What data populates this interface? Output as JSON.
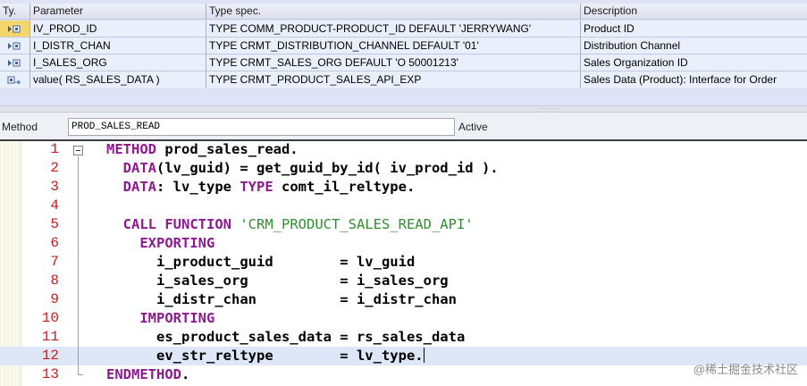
{
  "param_table": {
    "columns": [
      "Ty.",
      "Parameter",
      "Type spec.",
      "Description"
    ],
    "rows": [
      {
        "icon": "importing-param-icon",
        "parameter": "IV_PROD_ID",
        "type_spec": "TYPE COMM_PRODUCT-PRODUCT_ID  DEFAULT 'JERRYWANG'",
        "description": "Product ID",
        "selected": true
      },
      {
        "icon": "importing-param-icon",
        "parameter": "I_DISTR_CHAN",
        "type_spec": "TYPE CRMT_DISTRIBUTION_CHANNEL  DEFAULT '01'",
        "description": "Distribution Channel",
        "selected": false
      },
      {
        "icon": "importing-param-icon",
        "parameter": "I_SALES_ORG",
        "type_spec": "TYPE CRMT_SALES_ORG  DEFAULT 'O 50001213'",
        "description": "Sales Organization ID",
        "selected": false
      },
      {
        "icon": "returning-param-icon",
        "parameter": "value( RS_SALES_DATA )",
        "type_spec": "TYPE CRMT_PRODUCT_SALES_API_EXP",
        "description": "Sales Data (Product): Interface for Order",
        "selected": false
      }
    ]
  },
  "method_bar": {
    "label": "Method",
    "method_name": "PROD_SALES_READ",
    "status": "Active"
  },
  "editor": {
    "current_line": 12,
    "lines": [
      {
        "n": "1",
        "indent": "",
        "parts": [
          [
            "kw",
            "METHOD"
          ],
          [
            "t",
            " prod_sales_read."
          ]
        ]
      },
      {
        "n": "2",
        "indent": "  ",
        "parts": [
          [
            "kw",
            "DATA"
          ],
          [
            "t",
            "(lv_guid) = get_guid_by_id( iv_prod_id )."
          ]
        ]
      },
      {
        "n": "3",
        "indent": "  ",
        "parts": [
          [
            "kw",
            "DATA"
          ],
          [
            "t",
            ": lv_type "
          ],
          [
            "kw",
            "TYPE"
          ],
          [
            "t",
            " comt_il_reltype."
          ]
        ]
      },
      {
        "n": "4",
        "indent": "",
        "parts": []
      },
      {
        "n": "5",
        "indent": "  ",
        "parts": [
          [
            "kw",
            "CALL FUNCTION"
          ],
          [
            "t",
            " "
          ],
          [
            "str",
            "'CRM_PRODUCT_SALES_READ_API'"
          ]
        ]
      },
      {
        "n": "6",
        "indent": "    ",
        "parts": [
          [
            "kw",
            "EXPORTING"
          ]
        ]
      },
      {
        "n": "7",
        "indent": "      ",
        "parts": [
          [
            "t",
            "i_product_guid        = lv_guid"
          ]
        ]
      },
      {
        "n": "8",
        "indent": "      ",
        "parts": [
          [
            "t",
            "i_sales_org           = i_sales_org"
          ]
        ]
      },
      {
        "n": "9",
        "indent": "      ",
        "parts": [
          [
            "t",
            "i_distr_chan          = i_distr_chan"
          ]
        ]
      },
      {
        "n": "10",
        "indent": "    ",
        "parts": [
          [
            "kw",
            "IMPORTING"
          ]
        ]
      },
      {
        "n": "11",
        "indent": "      ",
        "parts": [
          [
            "t",
            "es_product_sales_data = rs_sales_data"
          ]
        ]
      },
      {
        "n": "12",
        "indent": "      ",
        "parts": [
          [
            "t",
            "ev_str_reltype        = lv_type."
          ]
        ]
      },
      {
        "n": "13",
        "indent": "",
        "parts": [
          [
            "kw",
            "ENDMETHOD"
          ],
          [
            "t",
            "."
          ]
        ]
      }
    ]
  },
  "watermark": "@稀土掘金技术社区",
  "colors": {
    "keyword": "#8e1a8f",
    "string": "#2f8f2f",
    "line_number": "#c81e1e",
    "selection_marker": "#f4d66b",
    "current_line_bg": "#dde7f7"
  }
}
